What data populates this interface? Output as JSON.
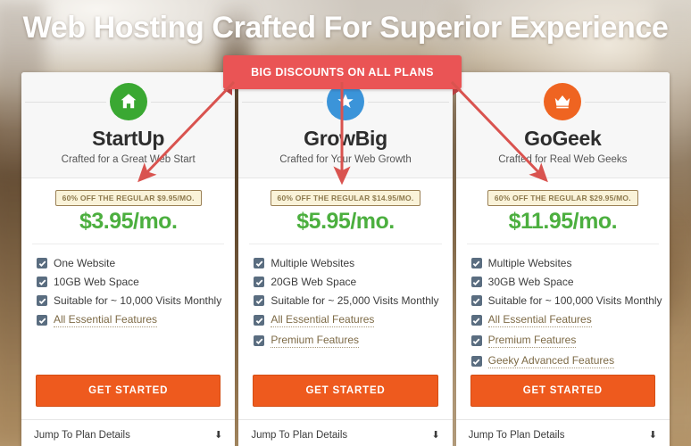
{
  "page": {
    "headline": "Web Hosting Crafted For Superior Experience",
    "ribbon_label": "BIG DISCOUNTS ON ALL PLANS",
    "accent_orange": "#ee5a1e",
    "accent_red": "#ea5455",
    "price_green": "#4caf3f",
    "badge_bg": "#faf3d9",
    "badge_border": "#9a8055",
    "card_bg": "#ffffff",
    "card_head_bg": "#f7f7f7"
  },
  "plans": [
    {
      "icon": "house-icon",
      "icon_color": "#3aa832",
      "name": "StartUp",
      "tagline": "Crafted for a Great Web Start",
      "discount": "60% OFF THE REGULAR $9.95/MO.",
      "price": "$3.95/mo.",
      "features": [
        {
          "label": "One Website",
          "link": false
        },
        {
          "label": "10GB Web Space",
          "link": false
        },
        {
          "label": "Suitable for ~ 10,000 Visits Monthly",
          "link": false
        },
        {
          "label": "All Essential Features",
          "link": true
        }
      ],
      "cta": "GET STARTED",
      "footer": "Jump To Plan Details",
      "footer_icon": "download-arrow-icon"
    },
    {
      "icon": "star-icon",
      "icon_color": "#3b94d9",
      "name": "GrowBig",
      "tagline": "Crafted for Your Web Growth",
      "discount": "60% OFF THE REGULAR $14.95/MO.",
      "price": "$5.95/mo.",
      "features": [
        {
          "label": "Multiple Websites",
          "link": false
        },
        {
          "label": "20GB Web Space",
          "link": false
        },
        {
          "label": "Suitable for ~ 25,000 Visits Monthly",
          "link": false
        },
        {
          "label": "All Essential Features",
          "link": true
        },
        {
          "label": "Premium Features",
          "link": true
        }
      ],
      "cta": "GET STARTED",
      "footer": "Jump To Plan Details",
      "footer_icon": "download-arrow-icon"
    },
    {
      "icon": "crown-icon",
      "icon_color": "#ef6421",
      "name": "GoGeek",
      "tagline": "Crafted for Real Web Geeks",
      "discount": "60% OFF THE REGULAR $29.95/MO.",
      "price": "$11.95/mo.",
      "features": [
        {
          "label": "Multiple Websites",
          "link": false
        },
        {
          "label": "30GB Web Space",
          "link": false
        },
        {
          "label": "Suitable for ~ 100,000 Visits Monthly",
          "link": false
        },
        {
          "label": "All Essential Features",
          "link": true
        },
        {
          "label": "Premium Features",
          "link": true
        },
        {
          "label": "Geeky Advanced Features",
          "link": true
        }
      ],
      "cta": "GET STARTED",
      "footer": "Jump To Plan Details",
      "footer_icon": "download-arrow-icon"
    }
  ]
}
